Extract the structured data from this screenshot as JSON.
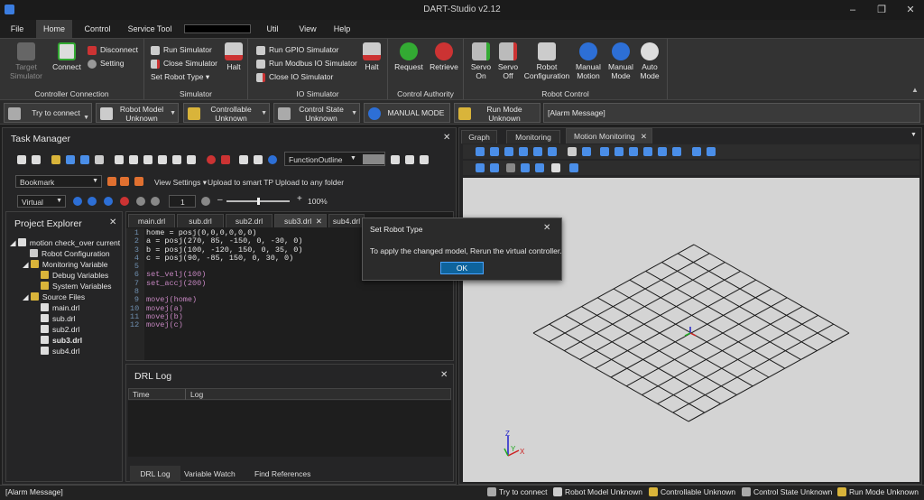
{
  "window": {
    "title": "DART-Studio v2.12"
  },
  "menu": {
    "items": [
      "File",
      "Home",
      "Control",
      "Service Tool",
      "Util",
      "View",
      "Help"
    ],
    "active": "Home"
  },
  "ribbon": {
    "controller_connection": {
      "label": "Controller Connection",
      "target_simulator": "Target Simulator",
      "connect": "Connect",
      "disconnect": "Disconnect",
      "setting": "Setting"
    },
    "simulator": {
      "label": "Simulator",
      "run": "Run Simulator",
      "close": "Close Simulator",
      "set_robot_type": "Set Robot Type",
      "halt": "Halt"
    },
    "io_simulator": {
      "label": "IO Simulator",
      "run_gpio": "Run GPIO Simulator",
      "run_modbus": "Run Modbus IO Simulator",
      "close_io": "Close IO Simulator",
      "halt": "Halt"
    },
    "control_authority": {
      "label": "Control Authority",
      "request": "Request",
      "retrieve": "Retrieve"
    },
    "robot_control": {
      "label": "Robot Control",
      "servo_on": "Servo On",
      "servo_off": "Servo Off",
      "robot_configuration": "Robot Configuration",
      "manual_motion": "Manual Motion",
      "manual_mode": "Manual Mode",
      "auto_mode": "Auto Mode"
    }
  },
  "status": {
    "try_to_connect": "Try to connect",
    "robot_model": "Robot Model Unknown",
    "controllable": "Controllable Unknown",
    "control_state": "Control State Unknown",
    "manual_mode": "MANUAL MODE",
    "run_mode": "Run Mode Unknown",
    "alarm": "[Alarm Message]"
  },
  "task_manager": {
    "title": "Task Manager",
    "function_outline": "FunctionOutline",
    "bookmark": "Bookmark",
    "view_settings": "View Settings",
    "upload_smart_tp": "Upload to smart TP",
    "upload_folder": "Upload to any folder",
    "mode": "Virtual",
    "speed_value": "1",
    "zoom": "100%"
  },
  "project_explorer": {
    "title": "Project Explorer",
    "root": "motion check_over current",
    "robot_configuration": "Robot Configuration",
    "monitoring_variable": "Monitoring Variable",
    "debug_variables": "Debug Variables",
    "system_variables": "System Variables",
    "source_files": "Source Files",
    "files": [
      "main.drl",
      "sub.drl",
      "sub2.drl",
      "sub3.drl",
      "sub4.drl"
    ]
  },
  "editor": {
    "tabs": [
      "main.drl",
      "sub.drl",
      "sub2.drl",
      "sub3.drl",
      "sub4.drl"
    ],
    "active_tab": "sub3.drl",
    "lines": [
      "home = posj(0,0,0,0,0,0)",
      "a = posj(270, 85, -150, 0, -30, 0)",
      "b = posj(100, -120, 150, 0, 35, 0)",
      "c = posj(90, -85, 150, 0, 30, 0)",
      "",
      "set_velj(100)",
      "set_accj(200)",
      "",
      "movej(home)",
      "movej(a)",
      "movej(b)",
      "movej(c)"
    ]
  },
  "drl_log": {
    "title": "DRL Log",
    "col_time": "Time",
    "col_log": "Log",
    "bottom_tabs": [
      "DRL Log",
      "Variable Watch",
      "Find References"
    ]
  },
  "right_panel": {
    "tabs": [
      "Graph",
      "Monitoring",
      "Motion Monitoring"
    ],
    "active_tab": "Motion Monitoring",
    "axis_x": "X",
    "axis_y": "Y",
    "axis_z": "Z"
  },
  "dialog": {
    "title": "Set Robot Type",
    "message": "To apply the changed model, Rerun the virtual controller.",
    "ok": "OK"
  },
  "bottom_bar": {
    "alarm": "[Alarm Message]",
    "try_to_connect": "Try to connect",
    "robot_model": "Robot Model Unknown",
    "controllable": "Controllable Unknown",
    "control_state": "Control State Unknown",
    "run_mode": "Run Mode Unknown"
  },
  "colors": {
    "accent": "#1e90ff",
    "ok_button": "#0e639c",
    "grid_bg": "#d4d4d4"
  }
}
